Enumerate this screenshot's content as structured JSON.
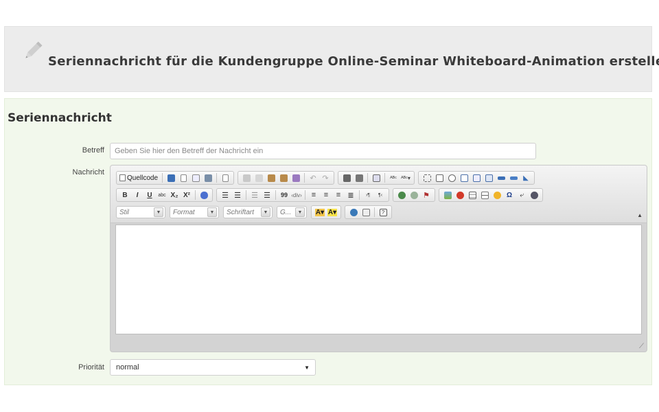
{
  "header": {
    "title": "Seriennachricht für die Kundengruppe Online-Seminar Whiteboard-Animation erstellen."
  },
  "panel": {
    "title": "Seriennachricht"
  },
  "form": {
    "subject_label": "Betreff",
    "subject_placeholder": "Geben Sie hier den Betreff der Nachricht ein",
    "subject_value": "",
    "message_label": "Nachricht",
    "priority_label": "Priorität",
    "priority_value": "normal"
  },
  "editor": {
    "source_label": "Quellcode",
    "combos": [
      "Stil",
      "Format",
      "Schriftart",
      "G..."
    ],
    "row2_text": {
      "bold": "B",
      "italic": "I",
      "underline": "U",
      "strike": "abc",
      "subscript": "X₂",
      "superscript": "X²",
      "blockquote": "99"
    },
    "icons_row1": [
      "source-icon",
      "save-icon",
      "new-page-icon",
      "preview-icon",
      "print-icon",
      "templates-icon",
      "cut-icon",
      "copy-icon",
      "paste-icon",
      "paste-text-icon",
      "paste-word-icon",
      "undo-icon",
      "redo-icon",
      "find-icon",
      "replace-icon",
      "select-all-icon",
      "spellcheck-icon",
      "scayt-icon",
      "form-icon",
      "checkbox-icon",
      "radio-icon",
      "textfield-icon",
      "textarea-icon",
      "select-icon",
      "button-icon",
      "image-button-icon",
      "hidden-field-icon"
    ],
    "icons_row2": [
      "remove-format-icon",
      "numbered-list-icon",
      "bulleted-list-icon",
      "outdent-icon",
      "indent-icon",
      "blockquote-icon",
      "div-icon",
      "align-left-icon",
      "align-center-icon",
      "align-right-icon",
      "justify-icon",
      "ltr-icon",
      "rtl-icon",
      "link-icon",
      "unlink-icon",
      "anchor-icon",
      "image-icon",
      "flash-icon",
      "table-icon",
      "horizontal-line-icon",
      "smiley-icon",
      "special-char-icon",
      "page-break-icon",
      "iframe-icon"
    ],
    "icons_row3": [
      "text-color-icon",
      "bg-color-icon",
      "maximize-icon",
      "show-blocks-icon",
      "about-icon"
    ],
    "colors": {
      "toolbar_top": "#f4f4f4",
      "toolbar_bottom": "#dedede",
      "frame": "#d3d3d3",
      "panel_bg": "#f2f8ec",
      "header_bg": "#ececec"
    }
  }
}
